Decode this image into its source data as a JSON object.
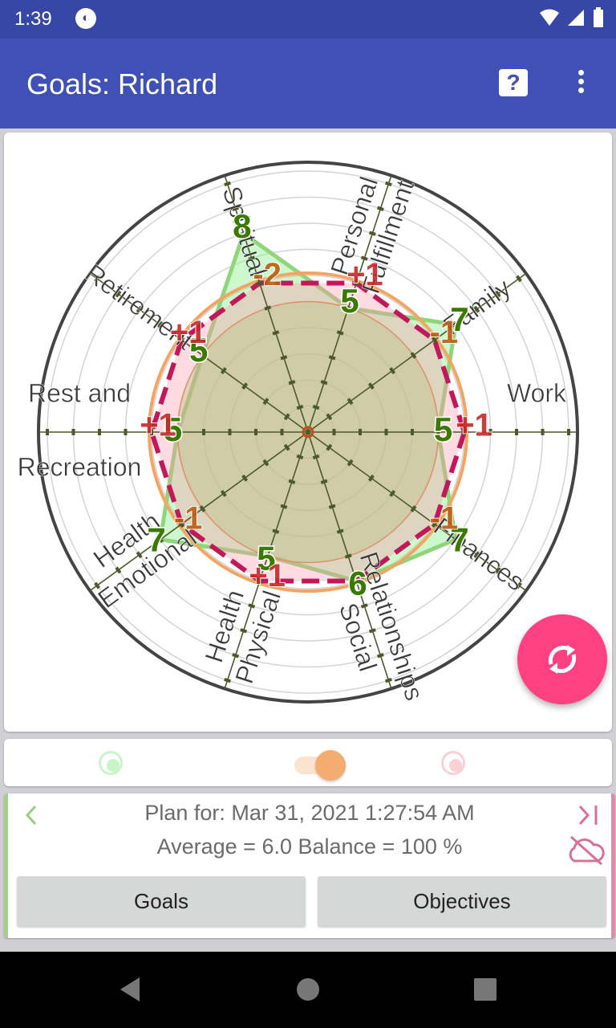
{
  "status_bar": {
    "time": "1:39"
  },
  "app_bar": {
    "title": "Goals: Richard",
    "help_icon": "help-icon",
    "menu_icon": "more-vert-icon"
  },
  "colors": {
    "app_bar": "#3f51b5",
    "actual": "#90ee90",
    "actual_label": "#3a7a00",
    "plan_dashed": "#c2185b",
    "change_label_pos": "#c62828",
    "change_label_neg": "#bf5a10",
    "average_circle": "#f4a460",
    "fab": "#ff4081"
  },
  "chart_data": {
    "type": "radar",
    "categories": [
      [
        "Work"
      ],
      [
        "Family"
      ],
      [
        "Personal",
        "Fulfillment"
      ],
      [
        "Spiritual"
      ],
      [
        "Retirement"
      ],
      [
        "Rest and",
        "Recreation"
      ],
      [
        "Emotional",
        "Health"
      ],
      [
        "Physical",
        "Health"
      ],
      [
        "Social",
        "Relationships"
      ],
      [
        "Finances"
      ]
    ],
    "rlim": [
      0,
      10
    ],
    "series": [
      {
        "values": [
          5,
          7,
          5,
          8,
          5,
          5,
          7,
          5,
          6,
          7
        ]
      },
      {
        "values": [
          6,
          6,
          6,
          6,
          6,
          6,
          6,
          6,
          6,
          6
        ]
      }
    ],
    "change_labels": [
      "+1",
      "-1",
      "+1",
      "-2",
      "+1",
      "+1",
      "-1",
      "+1",
      "",
      "-1"
    ],
    "average_circle": 6.0,
    "inner_circle": 5
  },
  "toggles": {
    "left": "actual-toggle",
    "middle": "average-switch",
    "right": "plan-toggle"
  },
  "plan": {
    "title": "Plan for: Mar 31, 2021 1:27:54 AM",
    "summary": "Average = 6.0 Balance = 100 %",
    "prev_icon": "chevron-left-icon",
    "last_icon": "skip-to-end-icon",
    "cloud_icon": "cloud-off-icon"
  },
  "buttons": {
    "goals": "Goals",
    "objectives": "Objectives"
  },
  "fab": {
    "icon": "sync-icon"
  }
}
